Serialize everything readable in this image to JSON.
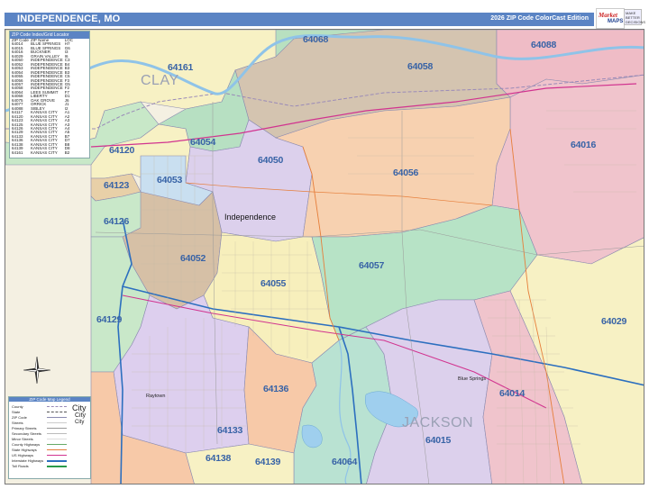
{
  "header": {
    "title": "INDEPENDENCE, MO",
    "edition": "2026 ZIP Code ColorCast Edition"
  },
  "logo": {
    "brand_top": "Market",
    "brand_bottom": "MAPS",
    "tag": "MAKE BETTER DECISIONS"
  },
  "zip_index": {
    "title": "ZIP Code Index/Grid Locator",
    "columns": [
      "ZIP Code",
      "ZIP Name",
      "LOC"
    ],
    "rows": [
      [
        "64014",
        "BLUE SPRINGS",
        "H7"
      ],
      [
        "64015",
        "BLUE SPRINGS",
        "G6"
      ],
      [
        "64016",
        "BUCKNER",
        "I3"
      ],
      [
        "64029",
        "GRAIN VALLEY",
        "I6"
      ],
      [
        "64050",
        "INDEPENDENCE",
        "C3"
      ],
      [
        "64052",
        "INDEPENDENCE",
        "B4"
      ],
      [
        "64053",
        "INDEPENDENCE",
        "B3"
      ],
      [
        "64054",
        "INDEPENDENCE",
        "B3"
      ],
      [
        "64055",
        "INDEPENDENCE",
        "C5"
      ],
      [
        "64056",
        "INDEPENDENCE",
        "F3"
      ],
      [
        "64057",
        "INDEPENDENCE",
        "G5"
      ],
      [
        "64058",
        "INDEPENDENCE",
        "F2"
      ],
      [
        "64064",
        "LEES SUMMIT",
        "F7"
      ],
      [
        "64068",
        "LIBERTY",
        "D1"
      ],
      [
        "64075",
        "OAK GROVE",
        "J6"
      ],
      [
        "64077",
        "ORRICK",
        "J1"
      ],
      [
        "64088",
        "SIBLEY",
        "I2"
      ],
      [
        "64117",
        "KANSAS CITY",
        "A1"
      ],
      [
        "64120",
        "KANSAS CITY",
        "A2"
      ],
      [
        "64123",
        "KANSAS CITY",
        "A3"
      ],
      [
        "64125",
        "KANSAS CITY",
        "A3"
      ],
      [
        "64126",
        "KANSAS CITY",
        "A4"
      ],
      [
        "64129",
        "KANSAS CITY",
        "A5"
      ],
      [
        "64133",
        "KANSAS CITY",
        "B7"
      ],
      [
        "64136",
        "KANSAS CITY",
        "D7"
      ],
      [
        "64138",
        "KANSAS CITY",
        "B8"
      ],
      [
        "64139",
        "KANSAS CITY",
        "D8"
      ],
      [
        "64161",
        "KANSAS CITY",
        "B2"
      ]
    ]
  },
  "legend": {
    "title": "ZIP Code Map Legend",
    "items": [
      "County",
      "State",
      "ZIP Code",
      "Streets",
      "Primary Streets",
      "Secondary Streets",
      "Minor Streets",
      "County Highways",
      "State Highways",
      "US Highways",
      "Interstate Highways",
      "Toll Roads"
    ],
    "city_large": "City",
    "city_medium": "City",
    "city_small": "City"
  },
  "map_labels": {
    "zips": [
      {
        "code": "64068"
      },
      {
        "code": "64088"
      },
      {
        "code": "64058"
      },
      {
        "code": "64161"
      },
      {
        "code": "64054"
      },
      {
        "code": "64016"
      },
      {
        "code": "64050"
      },
      {
        "code": "64120"
      },
      {
        "code": "64053"
      },
      {
        "code": "64056"
      },
      {
        "code": "64123"
      },
      {
        "code": "64126"
      },
      {
        "code": "64057"
      },
      {
        "code": "64052"
      },
      {
        "code": "64055"
      },
      {
        "code": "64129"
      },
      {
        "code": "64029"
      },
      {
        "code": "64136"
      },
      {
        "code": "64014"
      },
      {
        "code": "64133"
      },
      {
        "code": "64015"
      },
      {
        "code": "64138"
      },
      {
        "code": "64139"
      },
      {
        "code": "64064"
      }
    ],
    "counties": [
      "CLAY",
      "JACKSON"
    ],
    "places": {
      "independence": "Independence",
      "blue_springs": "Blue Springs",
      "raytown": "Raytown"
    }
  },
  "colors": {
    "title_bar": "#5b84c4",
    "zip_label": "#3863a6",
    "interstate": "#2c6fbf",
    "us_highway": "#d1338f",
    "river": "#8fc3e8",
    "lake": "#9fcfee"
  }
}
